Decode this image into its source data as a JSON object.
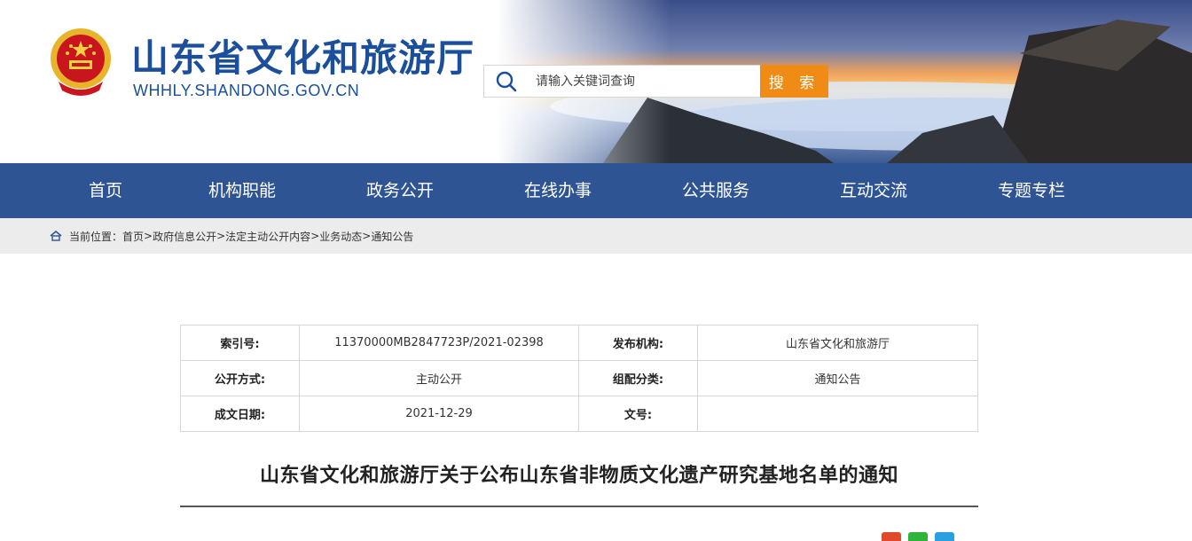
{
  "header": {
    "site_title": "山东省文化和旅游厅",
    "site_domain": "WHHLY.SHANDONG.GOV.CN",
    "search": {
      "placeholder": "请输入关键词查询",
      "button_label": "搜 索"
    }
  },
  "nav": {
    "items": [
      {
        "label": "首页"
      },
      {
        "label": "机构职能"
      },
      {
        "label": "政务公开"
      },
      {
        "label": "在线办事"
      },
      {
        "label": "公共服务"
      },
      {
        "label": "互动交流"
      },
      {
        "label": "专题专栏"
      }
    ]
  },
  "breadcrumb": {
    "prefix": "当前位置：",
    "items": [
      "首页",
      "政府信息公开",
      "法定主动公开内容",
      "业务动态",
      "通知公告"
    ],
    "separator": ">"
  },
  "meta": {
    "rows": [
      {
        "label1": "索引号:",
        "value1": "11370000MB2847723P/2021-02398",
        "label2": "发布机构:",
        "value2": "山东省文化和旅游厅"
      },
      {
        "label1": "公开方式:",
        "value1": "主动公开",
        "label2": "组配分类:",
        "value2": "通知公告"
      },
      {
        "label1": "成文日期:",
        "value1": "2021-12-29",
        "label2": "文号:",
        "value2": ""
      }
    ]
  },
  "document": {
    "title": "山东省文化和旅游厅关于公布山东省非物质文化遗产研究基地名单的通知"
  },
  "colors": {
    "brand_blue": "#1b4f9c",
    "nav_bg": "#2f5494",
    "search_button": "#f08c16",
    "breadcrumb_bg": "#ececec"
  }
}
